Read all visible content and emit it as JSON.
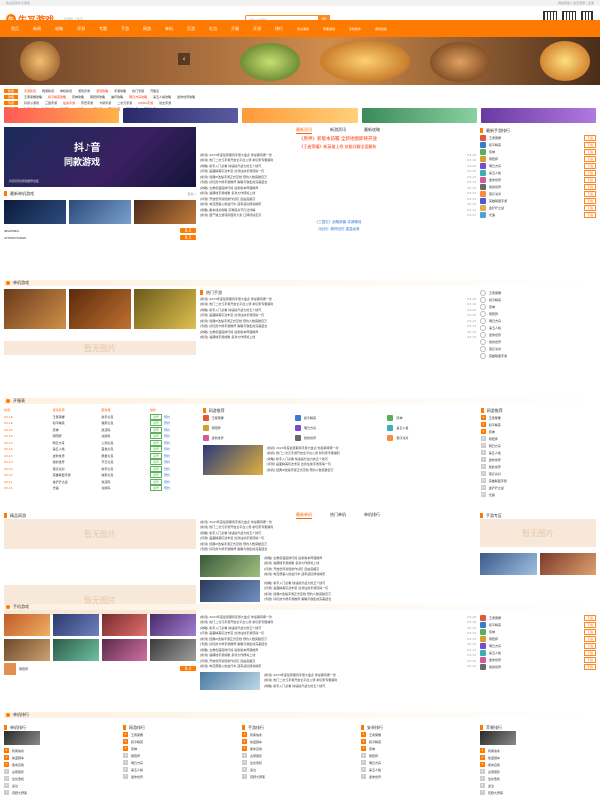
{
  "topbar": {
    "left": "欢迎来到牛叉游戏",
    "right": "网站导航 | 会员登录 | 注册"
  },
  "header": {
    "logo_mark": "牛",
    "logo_text": "牛叉游戏",
    "logo_sub": "玩游戏 上牛叉",
    "search_placeholder": "请输入关键词",
    "search_btn": "搜"
  },
  "nav": {
    "items": [
      "首页",
      "新闻",
      "攻略",
      "评测",
      "专题",
      "手游",
      "网游",
      "单机",
      "页游",
      "礼包",
      "开服",
      "开测",
      "排行"
    ],
    "sub": [
      "安卓游戏",
      "苹果游戏",
      "手机软件",
      "游戏合集"
    ]
  },
  "link_rows": [
    {
      "tag": "新闻",
      "links": [
        "手游新闻",
        "网游新闻",
        "单机新闻",
        "游戏评测",
        "游戏攻略",
        "手游攻略",
        "热门专题",
        "开服表"
      ]
    },
    {
      "tag": "攻略",
      "links": [
        "王者荣耀攻略",
        "和平精英攻略",
        "原神攻略",
        "阴阳师攻略",
        "崩坏攻略",
        "明日方舟攻略",
        "第五人格攻略",
        "迷你世界攻略"
      ]
    },
    {
      "tag": "专题",
      "links": [
        "抖音小游戏",
        "三国手游",
        "仙侠手游",
        "传奇手游",
        "卡牌手游",
        "二次元手游",
        "MOBA手游",
        "射击手游"
      ]
    },
    {
      "tag": "礼包",
      "links": [
        "新手礼包",
        "独家礼包",
        "激活码",
        "兑换码",
        "公测礼包",
        "首发礼包",
        "限量礼包",
        "节日礼包"
      ]
    }
  ],
  "douyin": {
    "t1": "抖♪音",
    "t2": "同款游戏",
    "cap": "抖音同款游戏推荐合集"
  },
  "left_games": {
    "title": "最新单机游戏",
    "more": "更多>",
    "items": [
      {
        "name": "INSOMNIA",
        "score": "8.4"
      },
      {
        "name": "AFTERCHARGE",
        "score": "8.5"
      }
    ]
  },
  "mid": {
    "tabs": [
      "最新资讯",
      "新游资讯",
      "最新攻略"
    ],
    "headlines": [
      "《原神》新版本前瞻 全新地图即将开放",
      "《王者荣耀》新英雄上线 技能详解全面解析"
    ],
    "news": [
      {
        "text": "[新闻] 2023年度最受期待手游大盘点 你最期待哪一款",
        "date": "03-16"
      },
      {
        "text": "[新闻] 热门二次元手游开启全平台公测 新玩家专属福利",
        "date": "03-16"
      },
      {
        "text": "[攻略] 新手入门必看 快速提升战力的五个技巧",
        "date": "03-15"
      },
      {
        "text": "[评测] 画面精美玩法丰富 这款仙侠手游值得一玩",
        "date": "03-15"
      },
      {
        "text": "[新闻] 经典IP改编手游正式定档 预约人数突破百万",
        "date": "03-14"
      },
      {
        "text": "[专题] 好玩的卡牌手游推荐 策略与收集的完美结合",
        "date": "03-14"
      },
      {
        "text": "[攻略] 全角色强度排行榜 最新版本阵容推荐",
        "date": "03-13"
      },
      {
        "text": "[新闻] 暑期档手游前瞻 多款大作即将上线",
        "date": "03-13"
      },
      {
        "text": "[评测] 开放世界冒险新作试玩 自由度超高",
        "date": "03-12"
      },
      {
        "text": "[新闻] 电竞赛事火热进行中 冠军战队即将揭晓",
        "date": "03-12"
      },
      {
        "text": "[攻略] 副本通关攻略 高难度关节打法详解",
        "date": "03-11"
      },
      {
        "text": "[新闻] 国产独立游戏获国际大奖 口碑持续走高",
        "date": "03-11"
      }
    ],
    "highlights": [
      "《三国志》战略新篇 攻城略地",
      "《仙剑》情怀回归 重温经典"
    ]
  },
  "right_rank": {
    "title": "最新手游排行",
    "btn": "下载",
    "items": [
      "王者荣耀",
      "和平精英",
      "原神",
      "阴阳师",
      "明日方舟",
      "第五人格",
      "迷你世界",
      "我的世界",
      "蛋仔派对",
      "英雄联盟手游",
      "金铲铲之战",
      "光遇"
    ]
  },
  "sec2": {
    "title": "单机游戏",
    "tabs": [
      "最新单机",
      "热门单机",
      "单机排行"
    ],
    "table_title": "开服表",
    "table_head": [
      "时间",
      "游戏名称",
      "服务器",
      "操作"
    ],
    "table_btn": "领号",
    "table_btn2": "预约",
    "list_title": "热门手游",
    "side_title": "网游推荐",
    "grid_title": "精品网游"
  },
  "sec3": {
    "title": "手机游戏",
    "side_title": "手游专区",
    "placeholder": "暂无图片"
  },
  "footer": {
    "titles": [
      "单机排行",
      "网游排行",
      "手游排行",
      "安卓排行",
      "苹果排行"
    ],
    "items": [
      "刺客信条",
      "侠盗猎车",
      "使命召唤",
      "古墓丽影",
      "生化危机",
      "鬼泣",
      "荒野大镖客"
    ]
  }
}
